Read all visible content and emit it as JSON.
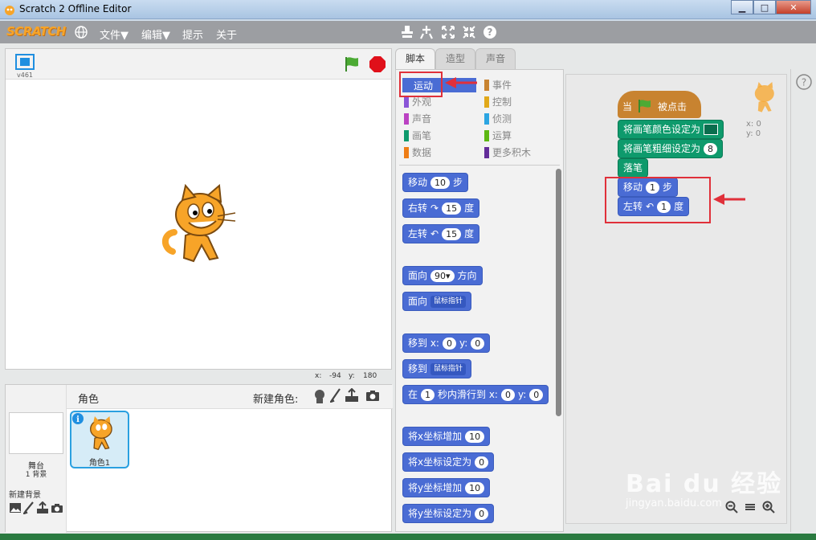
{
  "window": {
    "title": "Scratch 2 Offline Editor",
    "minimize": "▁",
    "maximize": "□",
    "close": "✕"
  },
  "menubar": {
    "logo": "SCRATCH",
    "file": "文件▼",
    "edit": "编辑▼",
    "tips": "提示",
    "about": "关于"
  },
  "stage": {
    "version": "v461",
    "mouse_x_label": "x:",
    "mouse_x": "-94",
    "mouse_y_label": "y:",
    "mouse_y": "180"
  },
  "sprites": {
    "header": "角色",
    "new_sprite_label": "新建角色:",
    "stage_label": "舞台",
    "backdrop_count": "1 背景",
    "new_backdrop_label": "新建背景",
    "sprite1_name": "角色1"
  },
  "tabs": {
    "scripts": "脚本",
    "costumes": "造型",
    "sounds": "声音"
  },
  "categories": [
    {
      "label": "运动",
      "color": "#4a6cd4"
    },
    {
      "label": "事件",
      "color": "#c88330"
    },
    {
      "label": "外观",
      "color": "#8a55d7"
    },
    {
      "label": "控制",
      "color": "#e1a91a"
    },
    {
      "label": "声音",
      "color": "#bb42c3"
    },
    {
      "label": "侦测",
      "color": "#2ca5e2"
    },
    {
      "label": "画笔",
      "color": "#0e9a6c"
    },
    {
      "label": "运算",
      "color": "#5cb712"
    },
    {
      "label": "数据",
      "color": "#ee7d16"
    },
    {
      "label": "更多积木",
      "color": "#632d99"
    }
  ],
  "palette_blocks": {
    "move": {
      "label": "移动",
      "value": "10",
      "unit": "步"
    },
    "turn_right": {
      "label": "右转",
      "value": "15",
      "unit": "度"
    },
    "turn_left": {
      "label": "左转",
      "value": "15",
      "unit": "度"
    },
    "point_dir": {
      "label": "面向",
      "value": "90▾",
      "unit": "方向"
    },
    "point_towards": {
      "label": "面向",
      "value": "鼠标指针"
    },
    "goto_xy": {
      "label": "移到 x:",
      "x": "0",
      "y_label": "y:",
      "y": "0"
    },
    "goto": {
      "label": "移到",
      "value": "鼠标指针"
    },
    "glide_prefix": "在",
    "glide_secs": "1",
    "glide_mid": "秒内滑行到 x:",
    "glide_x": "0",
    "glide_y_label": "y:",
    "glide_y": "0",
    "change_x": {
      "label": "将x坐标增加",
      "value": "10"
    },
    "set_x": {
      "label": "将x坐标设定为",
      "value": "0"
    },
    "change_y": {
      "label": "将y坐标增加",
      "value": "10"
    },
    "set_y": {
      "label": "将y坐标设定为",
      "value": "0"
    }
  },
  "script": {
    "hat_prefix": "当",
    "hat_suffix": "被点击",
    "pen_color": "将画笔颜色设定为",
    "pen_size": "将画笔粗细设定为",
    "pen_size_value": "8",
    "pen_down": "落笔",
    "move": "移动",
    "move_value": "1",
    "move_unit": "步",
    "turn": "左转",
    "turn_value": "1",
    "turn_unit": "度",
    "sprite_x": "x: 0",
    "sprite_y": "y: 0"
  },
  "watermark": {
    "brand": "Bai du 经验",
    "url": "jingyan.baidu.com"
  },
  "colors": {
    "motion": "#4a6cd4",
    "events": "#c88330",
    "pen": "#0e9a6c",
    "highlight": "#e0303a"
  }
}
